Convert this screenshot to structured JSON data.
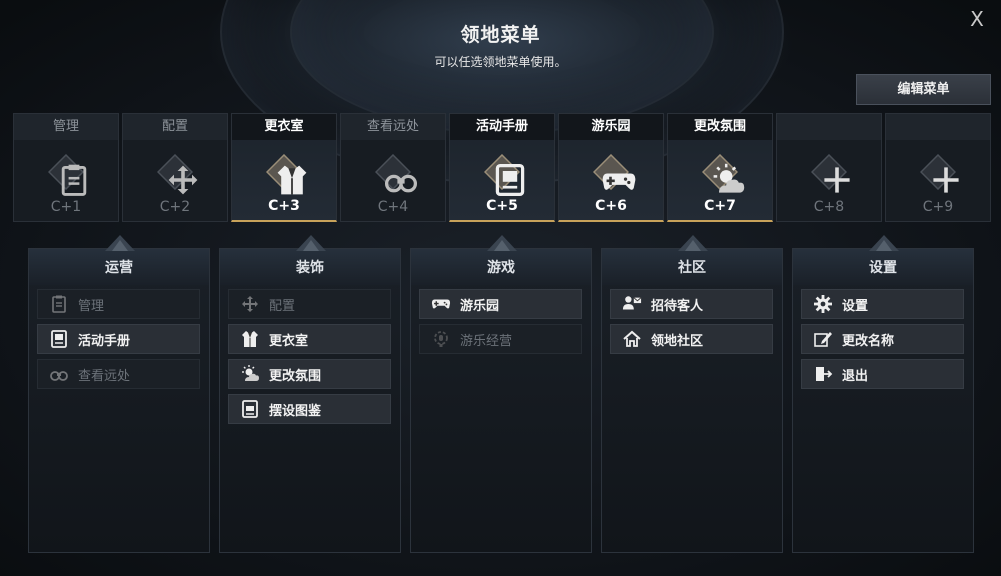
{
  "header": {
    "title": "领地菜单",
    "subtitle": "可以任选领地菜单使用。",
    "close_label": "X",
    "edit_label": "编辑菜单"
  },
  "shortcuts": [
    {
      "label": "管理",
      "key": "C+1",
      "active": false,
      "icon": "clipboard-icon"
    },
    {
      "label": "配置",
      "key": "C+2",
      "active": false,
      "icon": "move-arrows-icon"
    },
    {
      "label": "更衣室",
      "key": "C+3",
      "active": true,
      "icon": "jacket-icon"
    },
    {
      "label": "查看远处",
      "key": "C+4",
      "active": false,
      "icon": "binoculars-icon"
    },
    {
      "label": "活动手册",
      "key": "C+5",
      "active": true,
      "icon": "handbook-icon"
    },
    {
      "label": "游乐园",
      "key": "C+6",
      "active": true,
      "icon": "gamepad-icon"
    },
    {
      "label": "更改氛围",
      "key": "C+7",
      "active": true,
      "icon": "weather-icon"
    },
    {
      "label": "",
      "key": "C+8",
      "active": false,
      "icon": "plus-icon"
    },
    {
      "label": "",
      "key": "C+9",
      "active": false,
      "icon": "plus-icon"
    }
  ],
  "columns": [
    {
      "title": "运营",
      "items": [
        {
          "label": "管理",
          "dim": true,
          "icon": "clipboard-icon"
        },
        {
          "label": "活动手册",
          "dim": false,
          "icon": "handbook-icon"
        },
        {
          "label": "查看远处",
          "dim": true,
          "icon": "binoculars-icon"
        }
      ]
    },
    {
      "title": "装饰",
      "items": [
        {
          "label": "配置",
          "dim": true,
          "icon": "move-arrows-icon"
        },
        {
          "label": "更衣室",
          "dim": false,
          "icon": "jacket-icon"
        },
        {
          "label": "更改氛围",
          "dim": false,
          "icon": "weather-icon"
        },
        {
          "label": "摆设图鉴",
          "dim": false,
          "icon": "catalog-icon"
        }
      ]
    },
    {
      "title": "游戏",
      "items": [
        {
          "label": "游乐园",
          "dim": false,
          "icon": "gamepad-icon"
        },
        {
          "label": "游乐经营",
          "dim": true,
          "icon": "lightbulb-gear-icon"
        }
      ]
    },
    {
      "title": "社区",
      "items": [
        {
          "label": "招待客人",
          "dim": false,
          "icon": "invite-guest-icon"
        },
        {
          "label": "领地社区",
          "dim": false,
          "icon": "home-icon"
        }
      ]
    },
    {
      "title": "设置",
      "items": [
        {
          "label": "设置",
          "dim": false,
          "icon": "gear-icon"
        },
        {
          "label": "更改名称",
          "dim": false,
          "icon": "edit-icon"
        },
        {
          "label": "退出",
          "dim": false,
          "icon": "exit-icon"
        }
      ]
    }
  ],
  "colors": {
    "accent": "#c8a25a",
    "active_text": "#ffffff",
    "dim_text": "#6c7279"
  }
}
